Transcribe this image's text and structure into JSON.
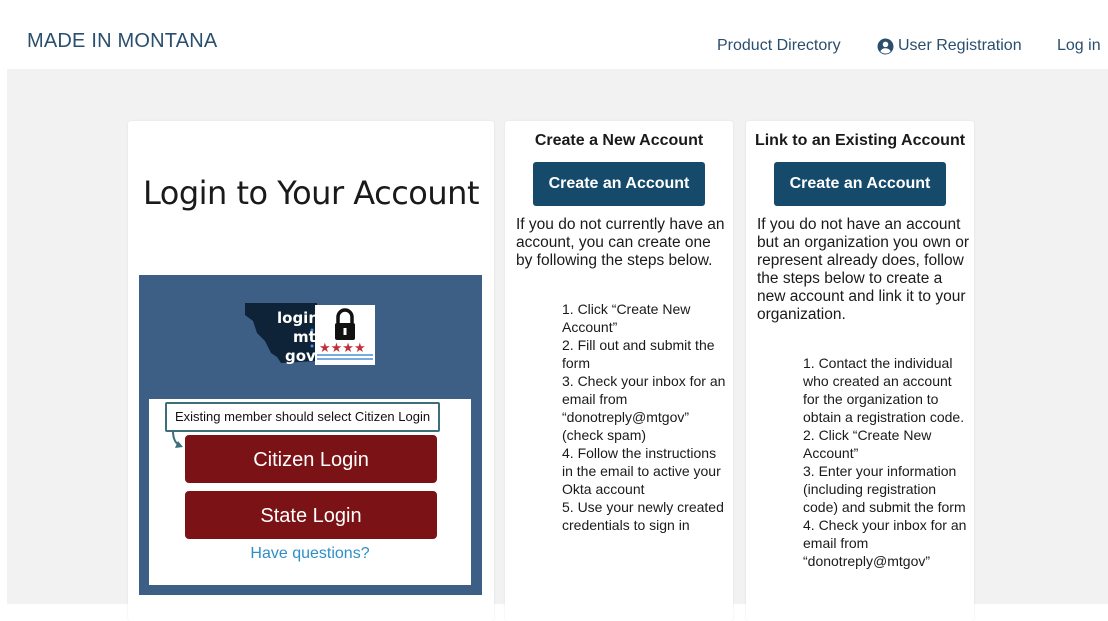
{
  "header": {
    "brand": "MADE IN MONTANA",
    "nav": {
      "product_directory": "Product Directory",
      "user_registration": "User Registration",
      "login": "Log in"
    }
  },
  "login_card": {
    "title": "Login to Your Account",
    "logo_text": [
      "login",
      "mt",
      "gov"
    ],
    "tooltip": "Existing member should select Citizen Login",
    "citizen_login": "Citizen Login",
    "state_login": "State Login",
    "have_questions": "Have questions?"
  },
  "new_account": {
    "heading": "Create a New Account",
    "button": "Create an Account",
    "intro": "If you do not currently have an account, you can create one by following the steps below.",
    "steps": [
      "1. Click “Create New Account”",
      "2. Fill out and submit the form",
      "3. Check your inbox for an email from “donotreply@mtgov” (check spam)",
      "4. Follow the instructions in the email to active your Okta account",
      "5. Use your newly created credentials to sign in"
    ]
  },
  "link_account": {
    "heading": "Link to an Existing Account",
    "button": "Create an Account",
    "intro": "If you do not have an account but an organization you own or represent already does, follow the steps below to create a new account and link it to your organization.",
    "steps": [
      "1. Contact the individual who created an account for the organization to obtain a registration code.",
      "2. Click “Create New Account”",
      "3. Enter your information (including registration code) and submit the form",
      "4. Check your inbox for an email from “donotreply@mtgov”"
    ]
  },
  "colors": {
    "brand_text": "#2a4e6e",
    "login_red": "#7b1316",
    "account_blue": "#154a6b",
    "panel_blue": "#3d5f86",
    "link_blue": "#2e8fc8"
  }
}
